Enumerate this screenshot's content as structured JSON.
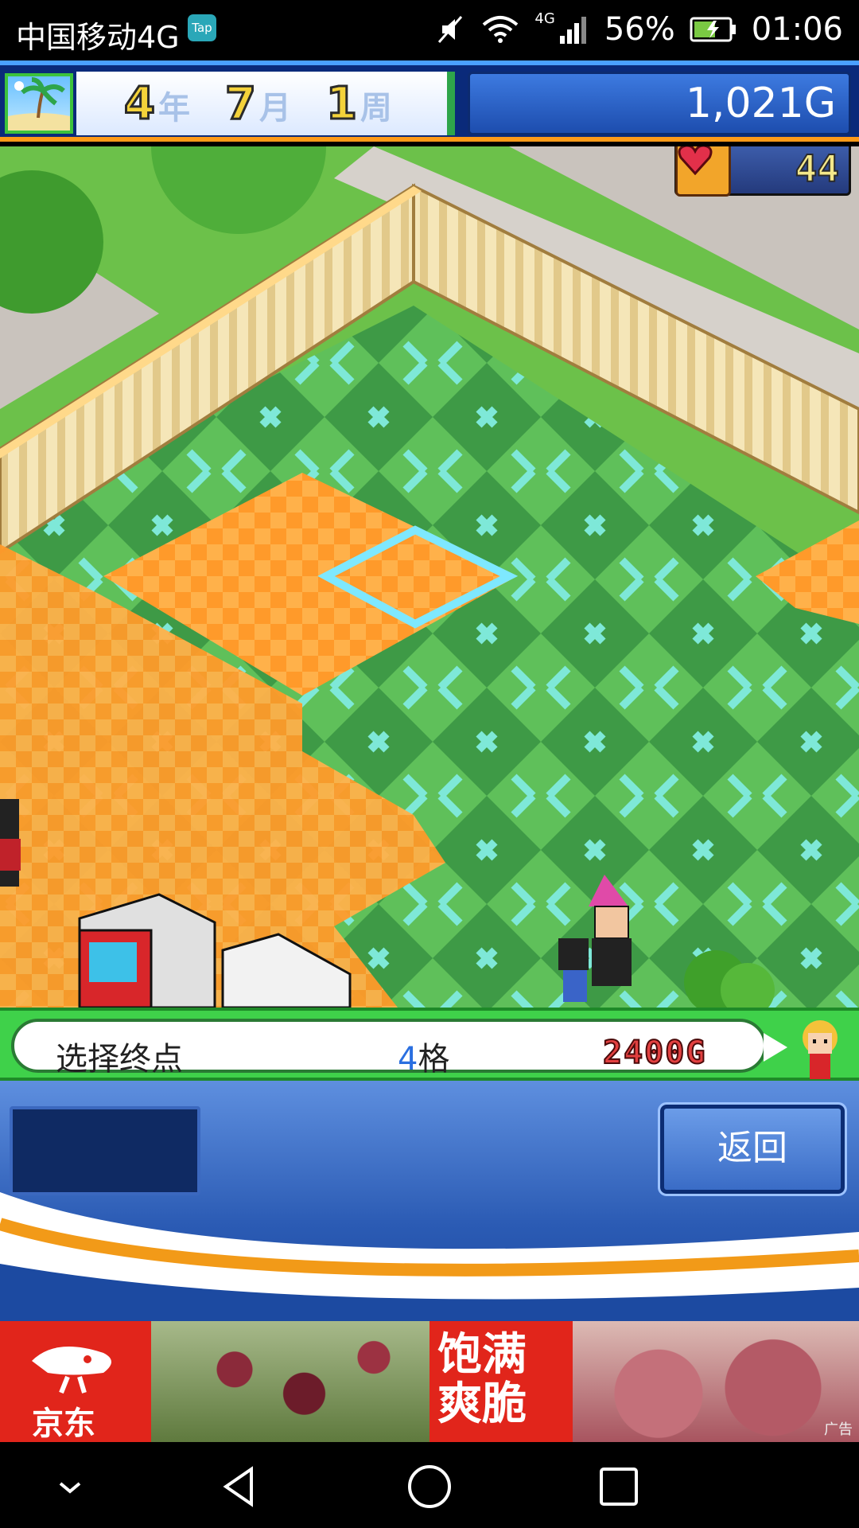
{
  "status_bar": {
    "carrier": "中国移动4G",
    "tap_badge": "Tap",
    "network": "4G",
    "battery": "56%",
    "time": "01:06"
  },
  "hud": {
    "year_num": "4",
    "year_unit": "年",
    "month_num": "7",
    "month_unit": "月",
    "week_num": "1",
    "week_unit": "周",
    "money": "1,021G",
    "hearts": "44"
  },
  "info_bar": {
    "prompt": "选择终点",
    "tiles_num": "4",
    "tiles_unit": "格",
    "cost": "2400G"
  },
  "panel": {
    "back_label": "返回"
  },
  "ad": {
    "brand": "京东",
    "slogan_line1": "饱满",
    "slogan_line2": "爽脆",
    "tag": "广告"
  },
  "colors": {
    "accent_blue": "#2a6fe0",
    "cost_red": "#e24040",
    "floor_green": "#5fc05a",
    "floor_orange": "#ff9a2a",
    "selection_cyan": "#7ee8ff"
  }
}
